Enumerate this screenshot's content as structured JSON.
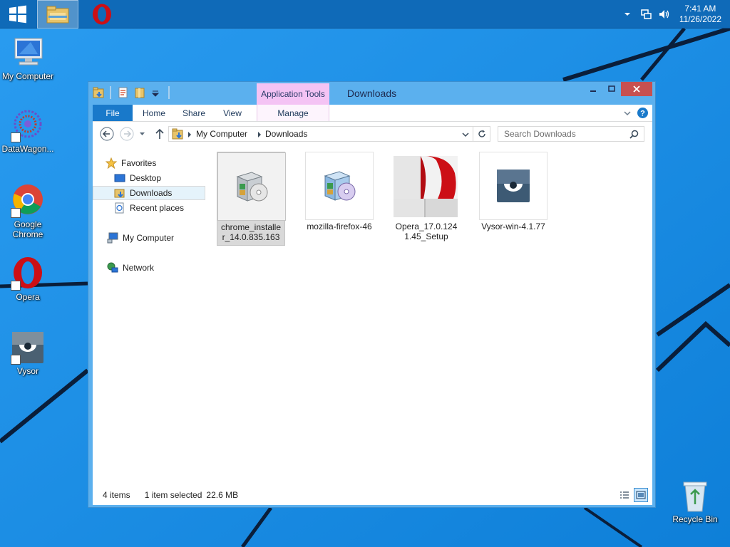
{
  "taskbar": {
    "clock": {
      "time": "7:41 AM",
      "date": "11/26/2022"
    },
    "tray_icons": [
      "chevron-up-icon",
      "network-icon",
      "volume-icon"
    ]
  },
  "desktop": {
    "icons": [
      {
        "label": "My Computer",
        "icon": "computer-icon"
      },
      {
        "label": "DataWagon...",
        "icon": "datawagon-icon"
      },
      {
        "label": "Google Chrome",
        "icon": "chrome-icon"
      },
      {
        "label": "Opera",
        "icon": "opera-icon"
      },
      {
        "label": "Vysor",
        "icon": "vysor-icon"
      },
      {
        "label": "Recycle Bin",
        "icon": "recycle-bin-icon"
      }
    ]
  },
  "window": {
    "title": "Downloads",
    "contextual_tab": "Application Tools",
    "ribbon_tabs": [
      "File",
      "Home",
      "Share",
      "View",
      "Manage"
    ],
    "address": {
      "root": "My Computer",
      "current": "Downloads"
    },
    "search": {
      "placeholder": "Search Downloads",
      "value": ""
    },
    "nav_pane": {
      "favorites_label": "Favorites",
      "favorites": [
        "Desktop",
        "Downloads",
        "Recent places"
      ],
      "selected": "Downloads",
      "computer": "My Computer",
      "network": "Network"
    },
    "files": [
      {
        "name": "chrome_installer_14.0.835.163",
        "icon": "installer-icon",
        "selected": true
      },
      {
        "name": "mozilla-firefox-46",
        "icon": "installer-icon",
        "selected": false
      },
      {
        "name": "Opera_17.0.1241.45_Setup",
        "icon": "opera-setup-icon",
        "selected": false
      },
      {
        "name": "Vysor-win-4.1.77",
        "icon": "vysor-icon",
        "selected": false
      }
    ],
    "status": {
      "item_count": "4 items",
      "selection": "1 item selected",
      "size": "22.6 MB"
    }
  },
  "colors": {
    "desktop_bg": "#1e8ee6",
    "taskbar": "#0f6ab8",
    "window_frame": "#5bb0ee",
    "close_button": "#c75050",
    "file_tab": "#1979ca",
    "contextual_tab": "#f4c3f4",
    "opera_red": "#cc0f16"
  }
}
